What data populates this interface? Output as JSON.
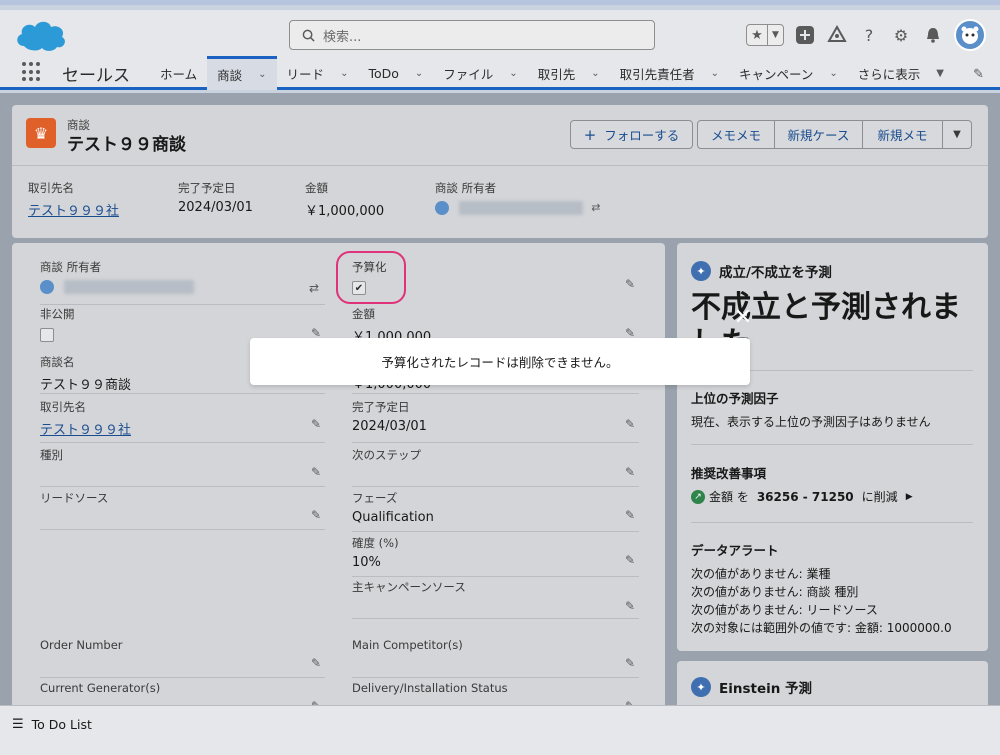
{
  "app": {
    "name": "セールス"
  },
  "search": {
    "placeholder": "検索..."
  },
  "nav": {
    "tabs": [
      {
        "label": "ホーム"
      },
      {
        "label": "商談"
      },
      {
        "label": "リード"
      },
      {
        "label": "ToDo"
      },
      {
        "label": "ファイル"
      },
      {
        "label": "取引先"
      },
      {
        "label": "取引先責任者"
      },
      {
        "label": "キャンペーン"
      },
      {
        "label": "さらに表示"
      }
    ]
  },
  "record": {
    "type": "商談",
    "title": "テスト９９商談",
    "actions": {
      "follow": "フォローする",
      "memo_memo": "メモメモ",
      "new_case": "新規ケース",
      "new_memo": "新規メモ"
    },
    "highlights": [
      {
        "label": "取引先名",
        "value": "テスト９９９社"
      },
      {
        "label": "完了予定日",
        "value": "2024/03/01"
      },
      {
        "label": "金額",
        "value": "￥1,000,000"
      },
      {
        "label": "商談 所有者",
        "value": ""
      }
    ]
  },
  "details": {
    "left": [
      {
        "label": "商談 所有者",
        "value": ""
      },
      {
        "label": "非公開",
        "value": ""
      },
      {
        "label": "商談名",
        "value": "テスト９９商談"
      },
      {
        "label": "取引先名",
        "value": "テスト９９９社"
      },
      {
        "label": "種別",
        "value": ""
      },
      {
        "label": "リードソース",
        "value": ""
      },
      {
        "label": "Order Number",
        "value": ""
      },
      {
        "label": "Current Generator(s)",
        "value": ""
      }
    ],
    "right": [
      {
        "label": "予算化",
        "value": "✔"
      },
      {
        "label": "金額",
        "value": "￥1,000,000"
      },
      {
        "label": "",
        "value": "￥1,000,000"
      },
      {
        "label": "完了予定日",
        "value": "2024/03/01"
      },
      {
        "label": "次のステップ",
        "value": ""
      },
      {
        "label": "フェーズ",
        "value": "Qualification"
      },
      {
        "label": "確度 (%)",
        "value": "10%"
      },
      {
        "label": "主キャンペーンソース",
        "value": ""
      },
      {
        "label": "Main Competitor(s)",
        "value": ""
      },
      {
        "label": "Delivery/Installation Status",
        "value": ""
      }
    ]
  },
  "sidebar": {
    "einstein_title": "成立/不成立を予測",
    "prediction": "不成立と予測されました",
    "top_factors_title": "上位の予測因子",
    "top_factors_text": "現在、表示する上位の予測因子はありません",
    "improve_title": "推奨改善事項",
    "improve_label": "金額 を",
    "improve_range": "36256 - 71250",
    "improve_action": "に削減",
    "alerts_title": "データアラート",
    "alerts": [
      "次の値がありません: 業種",
      "次の値がありません: 商談 種別",
      "次の値がありません: リードソース",
      "次の対象には範囲外の値です: 金額: 1000000.0"
    ],
    "einstein2_title": "Einstein 予測"
  },
  "todo": {
    "label": "To Do List"
  },
  "toast": {
    "message": "予算化されたレコードは削除できません。"
  }
}
